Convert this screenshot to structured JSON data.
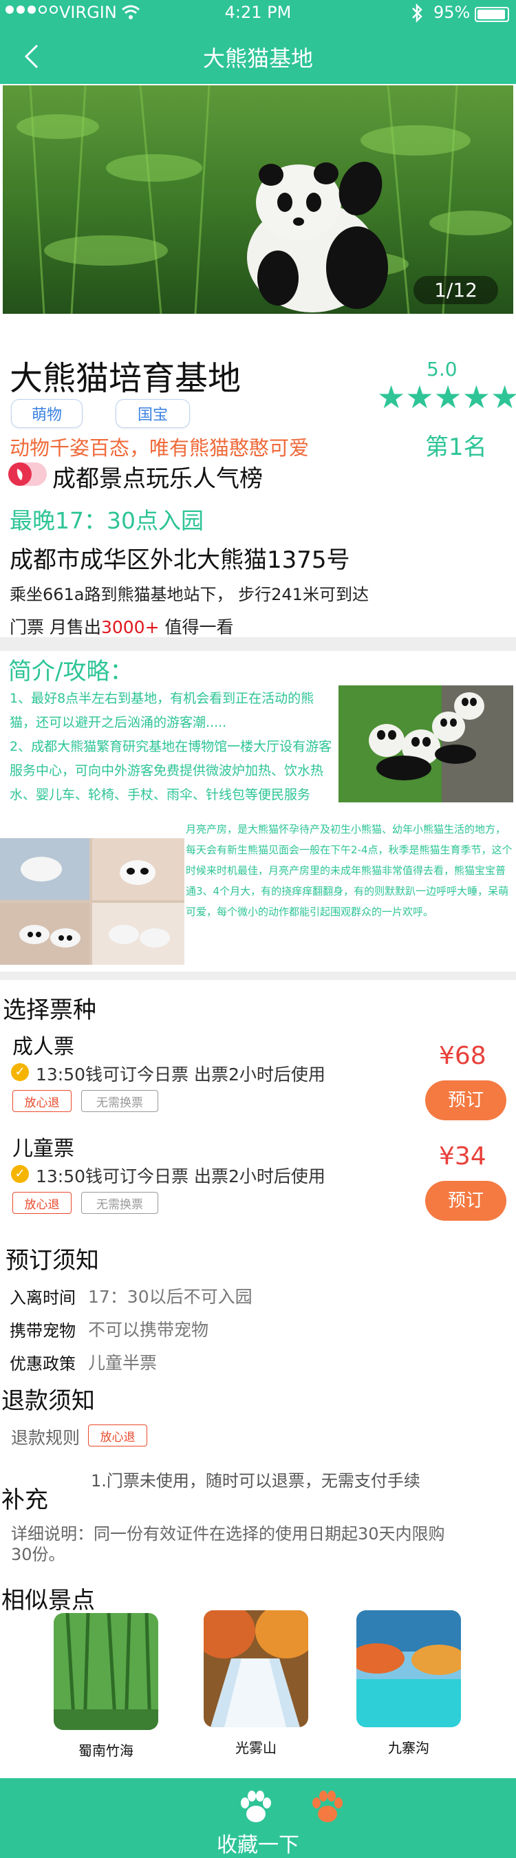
{
  "status_bar": {
    "carrier": "VIRGIN",
    "time": "4:21 PM",
    "battery_percent": "95%",
    "battery_level": 0.95,
    "signal_strength": "3/5",
    "icons": [
      "signal-dots",
      "wifi-icon",
      "bluetooth-icon",
      "battery-icon"
    ]
  },
  "nav": {
    "title": "大熊猫基地",
    "back_icon": "chevron-left-icon"
  },
  "hero": {
    "image": "panda-in-bamboo-photo",
    "counter": "1/12"
  },
  "attraction": {
    "name": "大熊猫培育基地",
    "rating": "5.0",
    "stars": 5,
    "tags": [
      "萌物",
      "国宝"
    ],
    "slogan": "动物千姿百态，唯有熊猫憨憨可爱",
    "rank": "第1名",
    "popular_list": "成都景点玩乐人气榜",
    "hours": "最晚17：30点入园",
    "address": "成都市成华区外北大熊猫1375号",
    "route": "乘坐661a路到熊猫基地站下， 步行241米可到达",
    "sales_prefix": "门票 月售出",
    "sales_count": "3000+",
    "sales_suffix": " 值得一看"
  },
  "intro": {
    "title": "简介/攻略：",
    "paragraph1": "1、最好8点半左右到基地，有机会看到正在活动的熊猫，还可以避开之后汹涌的游客潮.....",
    "paragraph2": "2、成都大熊猫繁育研究基地在博物馆一楼大厅设有游客服务中心，可向中外游客免费提供微波炉加热、饮水热水、婴儿车、轮椅、手杖、雨伞、针线包等便民服务",
    "paragraph3": "月亮产房，是大熊猫怀孕待产及初生小熊猫、幼年小熊猫生活的地方，每天会有新生熊猫见面会一般在下午2-4点，秋季是熊猫生育季节，这个时候来时机最佳，月亮产房里的未成年熊猫非常值得去看，熊猫宝宝普通3、4个月大，有的挠痒痒翻翻身，有的则默默趴一边呼呼大睡，呆萌可爱，每个微小的动作都能引起围观群众的一片欢呼。",
    "image1": "pandas-on-rock-photo",
    "image2": "baby-pandas-nursery-photo"
  },
  "tickets": {
    "title": "选择票种",
    "items": [
      {
        "name": "成人票",
        "desc": "13:50钱可订今日票 出票2小时后使用",
        "price": "¥68",
        "button": "预订",
        "badges": [
          "放心退",
          "无需换票"
        ]
      },
      {
        "name": "儿童票",
        "desc": "13:50钱可订今日票 出票2小时后使用",
        "price": "¥34",
        "button": "预订",
        "badges": [
          "放心退",
          "无需换票"
        ]
      }
    ]
  },
  "booking_notes": {
    "title": "预订须知",
    "rows": [
      {
        "label": "入离时间",
        "value": "17：30以后不可入园"
      },
      {
        "label": "携带宠物",
        "value": "不可以携带宠物"
      },
      {
        "label": "优惠政策",
        "value": "儿童半票"
      }
    ]
  },
  "refund": {
    "title": "退款须知",
    "label": "退款规则",
    "badge": "放心退",
    "text": "1.门票未使用，随时可以退票，无需支付手续"
  },
  "supplement": {
    "title": "补充",
    "text": "详细说明：同一份有效证件在选择的使用日期起30天内限购30份。"
  },
  "similar": {
    "title": "相似景点",
    "items": [
      {
        "label": "蜀南竹海",
        "image": "bamboo-forest-photo"
      },
      {
        "label": "光雾山",
        "image": "waterfall-autumn-photo"
      },
      {
        "label": "九寨沟",
        "image": "jiuzhaigou-lake-photo"
      }
    ]
  },
  "footer": {
    "collect": "收藏一下",
    "icons": [
      "paw-white-icon",
      "paw-orange-icon"
    ]
  }
}
